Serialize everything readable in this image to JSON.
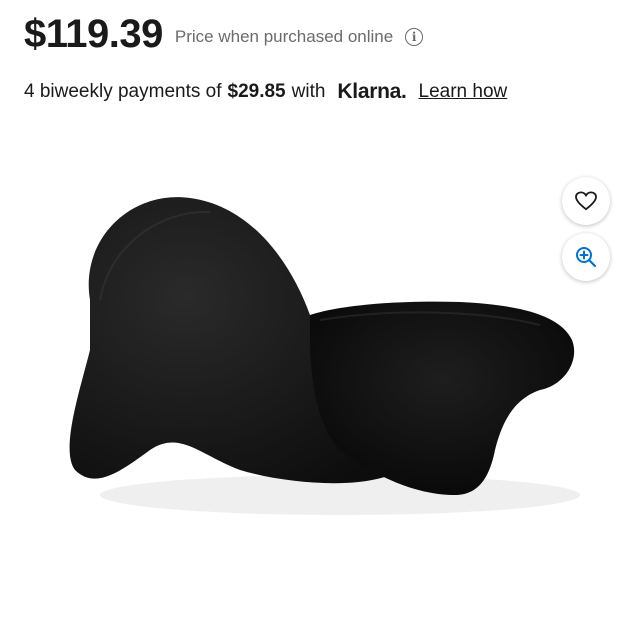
{
  "price": {
    "amount": "$119.39",
    "note": "Price when purchased online",
    "info_icon": "info-icon"
  },
  "payments": {
    "prefix": "4 biweekly payments of",
    "amount": "$29.85",
    "with": "with",
    "provider": "Klarna.",
    "learn_link": "Learn how"
  },
  "product_image": {
    "alt": "black sculptural curved chair"
  },
  "actions": {
    "favorite_icon": "heart-icon",
    "zoom_icon": "zoom-in-icon",
    "accent": "#0071dc"
  }
}
